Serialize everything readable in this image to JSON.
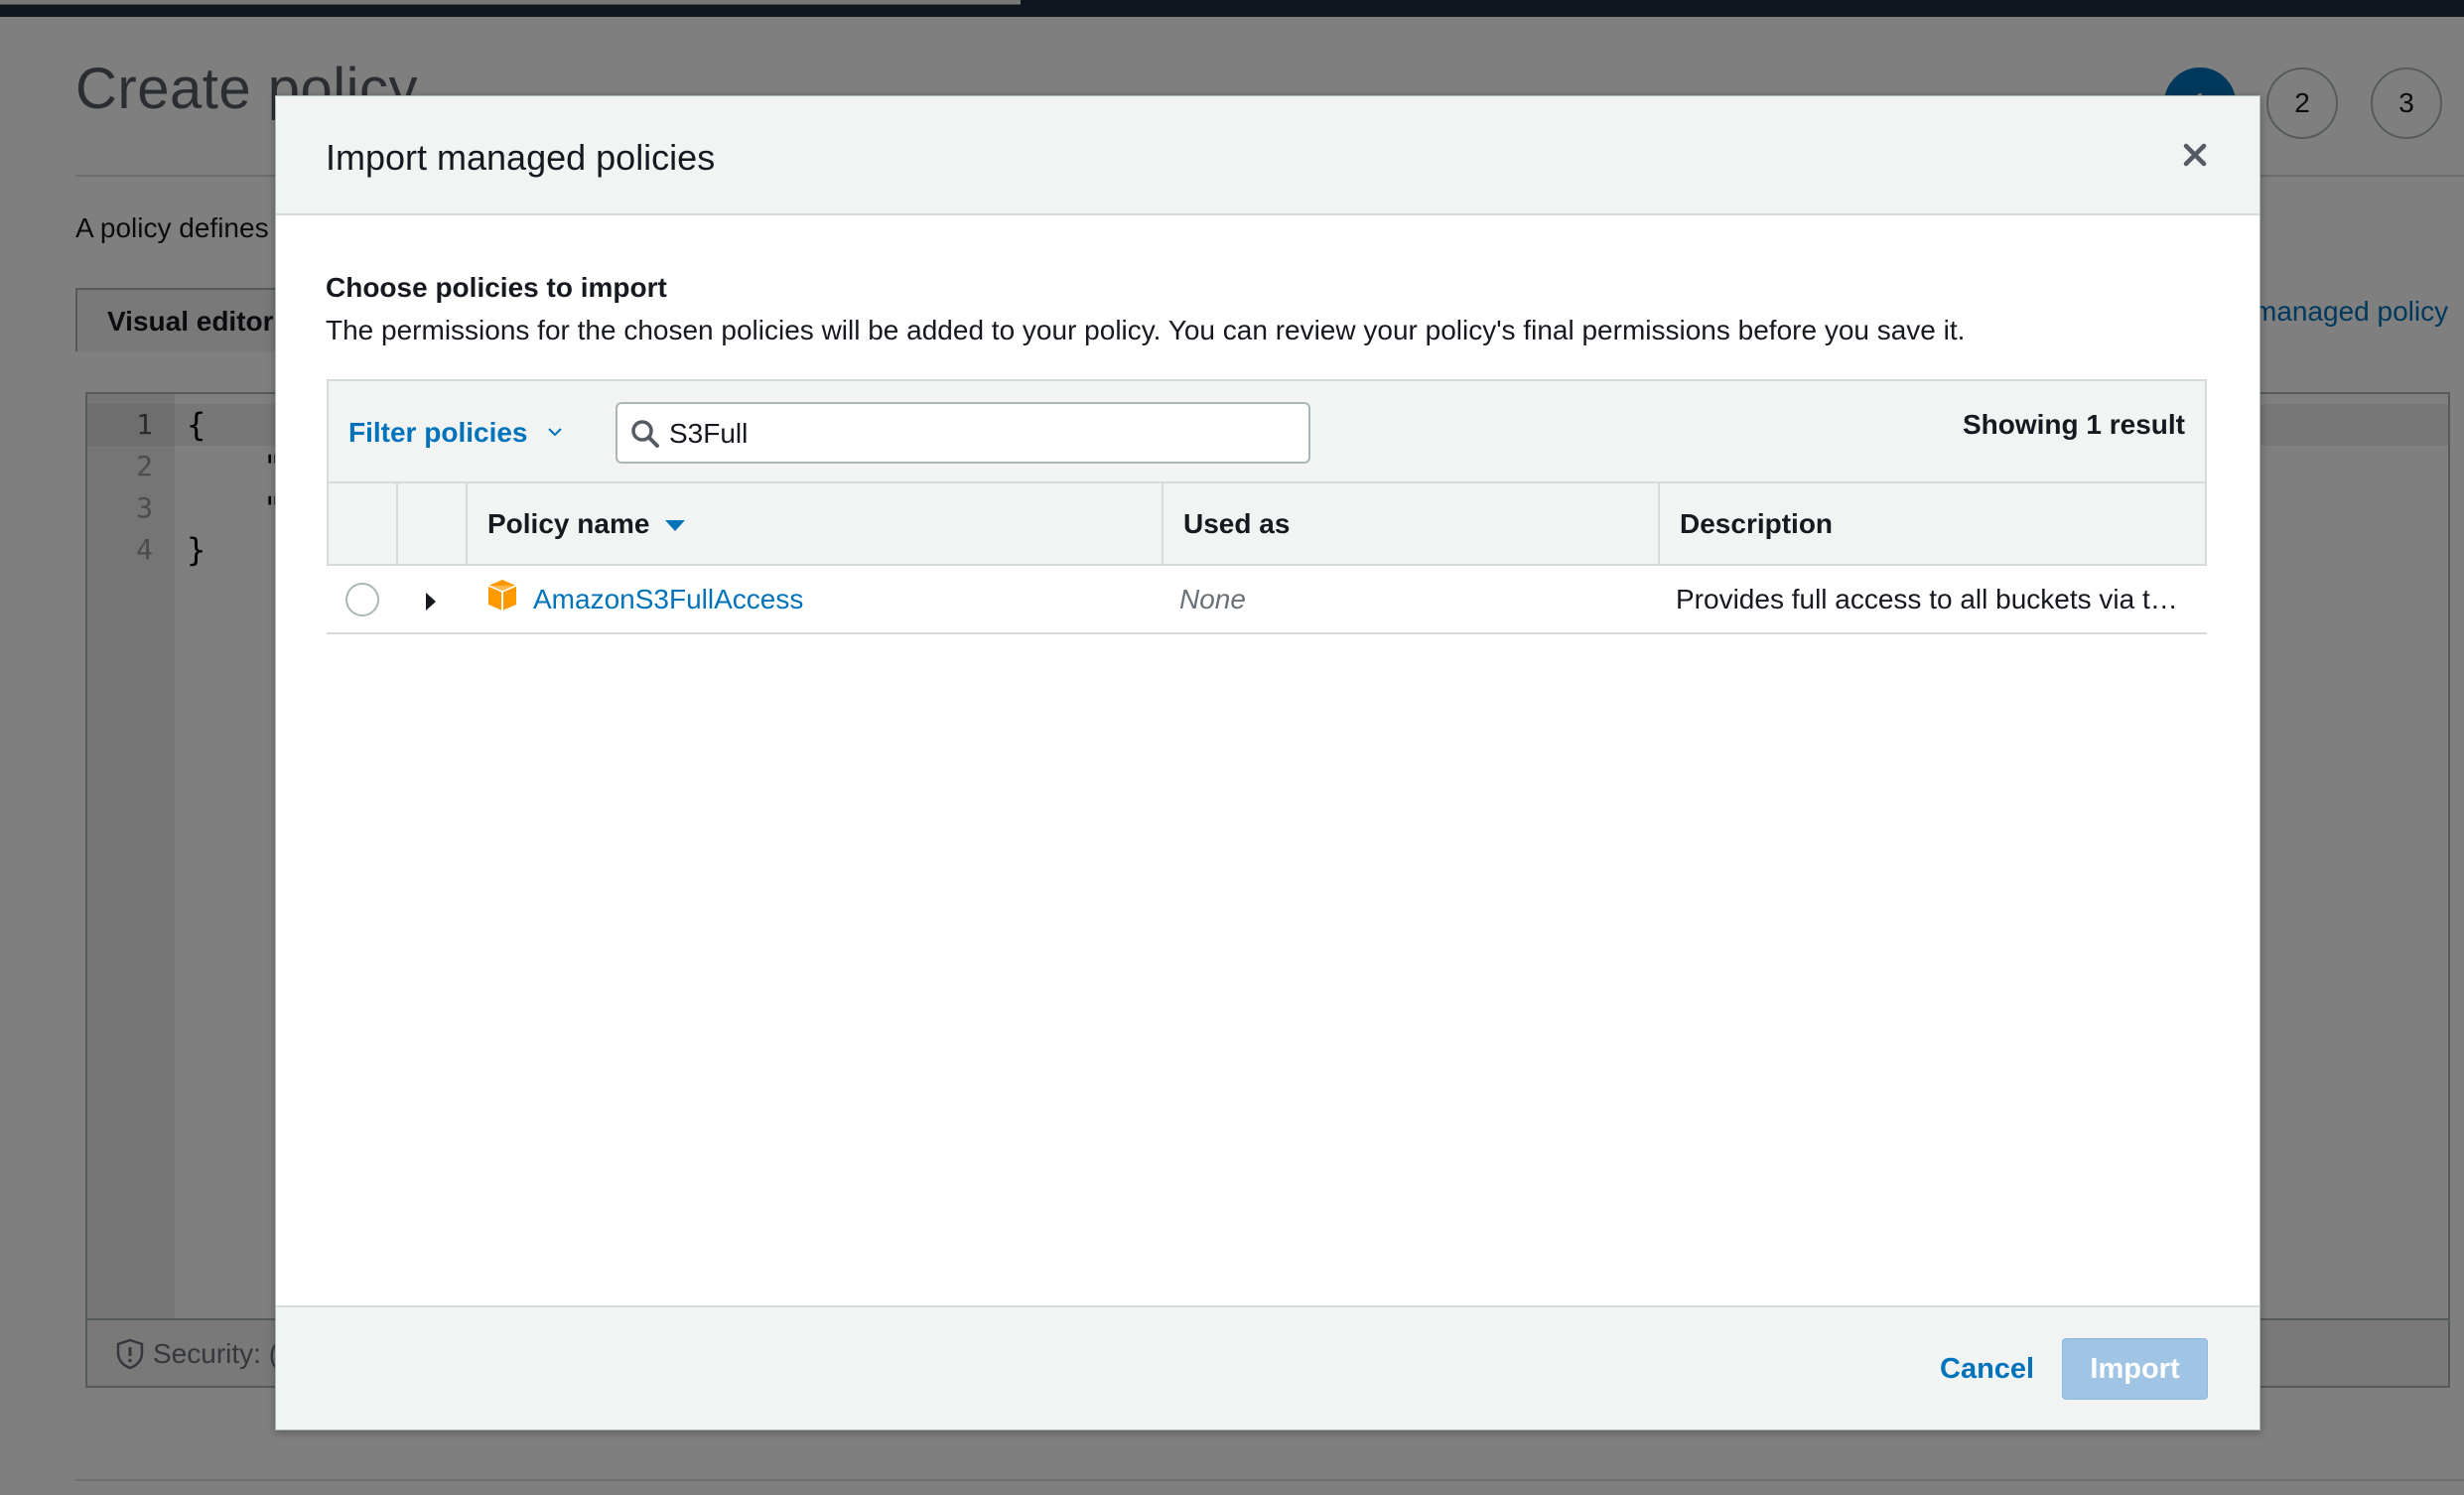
{
  "page": {
    "title": "Create policy",
    "description": "A policy defines",
    "steps": [
      "1",
      "2",
      "3"
    ],
    "active_step": "1",
    "tabs": {
      "visual_editor": "Visual editor"
    },
    "import_link": "managed policy",
    "editor": {
      "line_numbers": [
        "1",
        "2",
        "3",
        "4"
      ],
      "lines": [
        "{",
        "    \"",
        "    \"",
        "}"
      ],
      "footer_text": "Security: ("
    }
  },
  "modal": {
    "title": "Import managed policies",
    "close_icon": "close-icon",
    "section_heading": "Choose policies to import",
    "section_description": "The permissions for the chosen policies will be added to your policy. You can review your policy's final permissions before you save it.",
    "filter_label": "Filter policies",
    "search": {
      "value": "S3Full",
      "placeholder": ""
    },
    "result_count": "Showing 1 result",
    "columns": {
      "policy_name": "Policy name",
      "used_as": "Used as",
      "description": "Description"
    },
    "sort_direction": "descending",
    "rows": [
      {
        "name": "AmazonS3FullAccess",
        "used_as": "None",
        "description": "Provides full access to all buckets via t…",
        "selected": false,
        "icon": "aws-managed-policy-icon"
      }
    ],
    "buttons": {
      "cancel": "Cancel",
      "import": "Import"
    },
    "import_enabled": false
  },
  "colors": {
    "accent": "#0073bb",
    "header_bg": "#f2f3f3",
    "border": "#d5dbdb",
    "policy_icon": "#ff9900",
    "import_disabled": "#a0c4e4"
  }
}
